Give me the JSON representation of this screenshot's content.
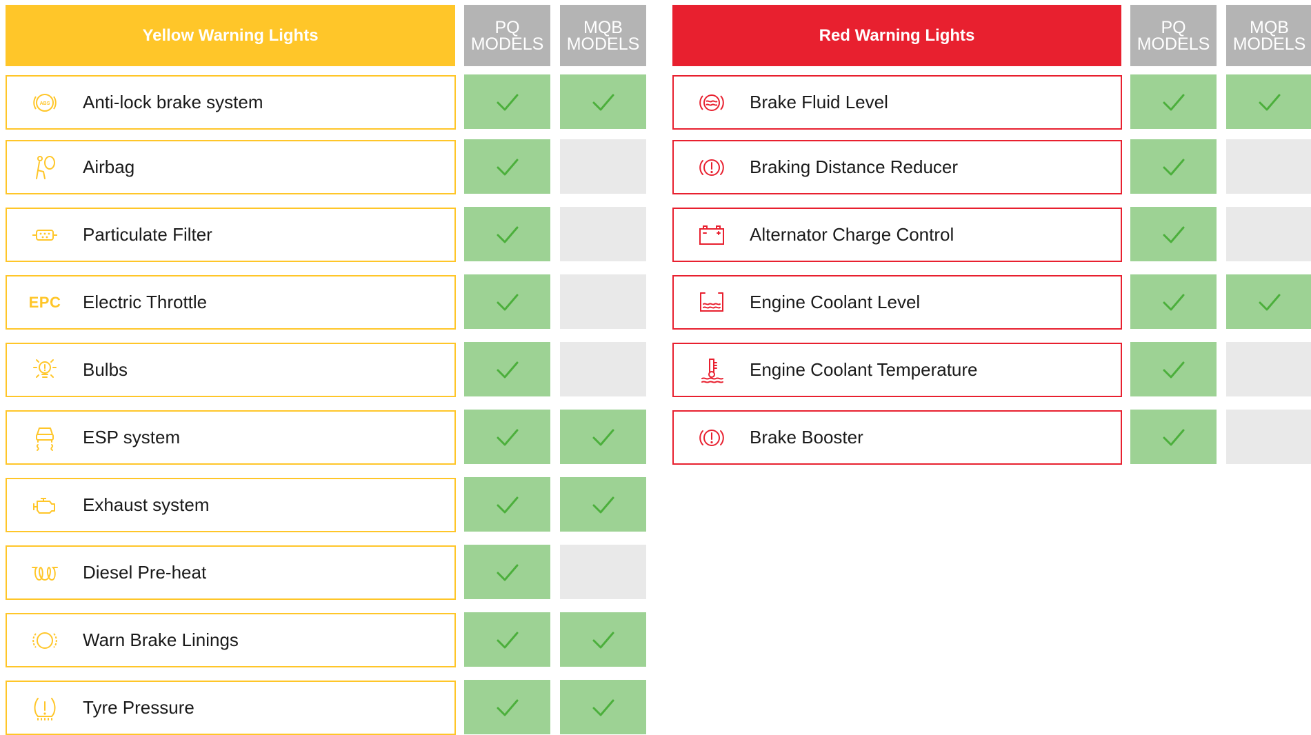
{
  "colors": {
    "yellow": "#ffc629",
    "red": "#e8202f",
    "column_header": "#b4b4b4",
    "supported": "#9dd294",
    "not_supported": "#e9e9e9",
    "check": "#4caf3c"
  },
  "yellow": {
    "title": "Yellow Warning Lights",
    "pq_header": [
      "PQ",
      "MODELS"
    ],
    "mqb_header": [
      "MQB",
      "MODELS"
    ],
    "items": [
      {
        "label": "Anti-lock brake system",
        "icon": "abs-icon",
        "pq": true,
        "mqb": true
      },
      {
        "label": "Airbag",
        "icon": "airbag-icon",
        "pq": true,
        "mqb": false
      },
      {
        "label": "Particulate Filter",
        "icon": "particulate-filter-icon",
        "pq": true,
        "mqb": false
      },
      {
        "label": "Electric Throttle",
        "icon": "epc-icon",
        "icon_text": "EPC",
        "pq": true,
        "mqb": false
      },
      {
        "label": "Bulbs",
        "icon": "bulb-icon",
        "pq": true,
        "mqb": false
      },
      {
        "label": "ESP system",
        "icon": "esp-icon",
        "pq": true,
        "mqb": true
      },
      {
        "label": "Exhaust system",
        "icon": "engine-icon",
        "pq": true,
        "mqb": true
      },
      {
        "label": "Diesel Pre-heat",
        "icon": "glow-plug-icon",
        "pq": true,
        "mqb": false
      },
      {
        "label": "Warn Brake Linings",
        "icon": "brake-lining-icon",
        "pq": true,
        "mqb": true
      },
      {
        "label": "Tyre Pressure",
        "icon": "tyre-pressure-icon",
        "pq": true,
        "mqb": true
      }
    ]
  },
  "red": {
    "title": "Red Warning Lights",
    "pq_header": [
      "PQ",
      "MODELS"
    ],
    "mqb_header": [
      "MQB",
      "MODELS"
    ],
    "items": [
      {
        "label": "Brake Fluid Level",
        "icon": "brake-fluid-icon",
        "pq": true,
        "mqb": true
      },
      {
        "label": "Braking Distance Reducer",
        "icon": "brake-warning-icon",
        "pq": true,
        "mqb": false
      },
      {
        "label": "Alternator Charge Control",
        "icon": "battery-icon",
        "pq": true,
        "mqb": false
      },
      {
        "label": "Engine Coolant Level",
        "icon": "coolant-level-icon",
        "pq": true,
        "mqb": true
      },
      {
        "label": "Engine Coolant Temperature",
        "icon": "coolant-temperature-icon",
        "pq": true,
        "mqb": false
      },
      {
        "label": "Brake Booster",
        "icon": "brake-booster-icon",
        "pq": true,
        "mqb": false
      }
    ]
  }
}
